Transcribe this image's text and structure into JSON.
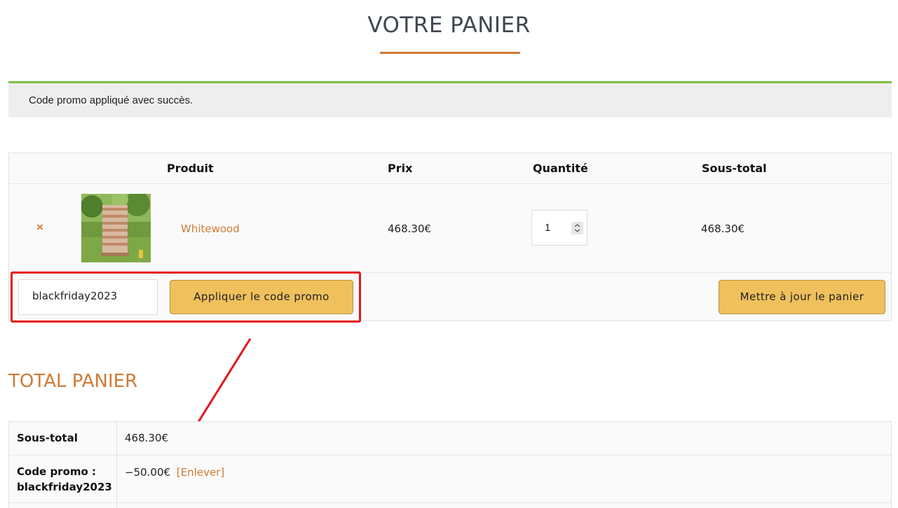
{
  "page": {
    "title": "VOTRE PANIER"
  },
  "notice": {
    "message": "Code promo appliqué avec succès."
  },
  "cart": {
    "headers": {
      "product": "Produit",
      "price": "Prix",
      "quantity": "Quantité",
      "subtotal": "Sous-total"
    },
    "item": {
      "remove_symbol": "×",
      "name": "Whitewood",
      "price": "468.30€",
      "quantity": "1",
      "subtotal": "468.30€"
    },
    "coupon": {
      "code_value": "blackfriday2023",
      "apply_label": "Appliquer le code promo",
      "update_label": "Mettre à jour le panier"
    }
  },
  "totals": {
    "title": "TOTAL PANIER",
    "subtotal_label": "Sous-total",
    "subtotal_value": "468.30€",
    "promo_label_line1": "Code promo :",
    "promo_label_line2": "blackfriday2023",
    "promo_value": "−50.00€",
    "promo_remove": "[Enlever]"
  },
  "colors": {
    "accent": "#d07a35",
    "success": "#7ac142",
    "button": "#efc05c",
    "annotation": "#e4161d"
  }
}
